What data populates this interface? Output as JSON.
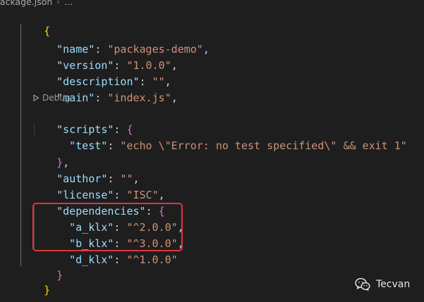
{
  "breadcrumb": {
    "file": "package.json",
    "ellipsis": "…"
  },
  "codelens": {
    "label": "Debug",
    "icon": "play-icon"
  },
  "code": {
    "open_brace": "{",
    "name_key": "\"name\"",
    "name_value": "\"packages-demo\"",
    "version_key": "\"version\"",
    "version_value": "\"1.0.0\"",
    "description_key": "\"description\"",
    "description_value": "\"\"",
    "main_key": "\"main\"",
    "main_value": "\"index.js\"",
    "scripts_key": "\"scripts\"",
    "test_key": "\"test\"",
    "test_value": "\"echo \\\"Error: no test specified\\\" && exit 1\"",
    "author_key": "\"author\"",
    "author_value": "\"\"",
    "license_key": "\"license\"",
    "license_value": "\"ISC\"",
    "dependencies_key": "\"dependencies\"",
    "dep1_key": "\"a_klx\"",
    "dep1_value": "\"^2.0.0\"",
    "dep2_key": "\"b_klx\"",
    "dep2_value": "\"^3.0.0\"",
    "dep3_key": "\"d_klx\"",
    "dep3_value": "\"^1.0.0\"",
    "inner_close": "}",
    "close_brace": "}"
  },
  "colors": {
    "background": "#1e1e1e",
    "key": "#9cdcfe",
    "string": "#ce9178",
    "highlight_border": "#e0353d"
  },
  "watermark": {
    "text": "Tecvan",
    "icon": "wechat-icon"
  }
}
